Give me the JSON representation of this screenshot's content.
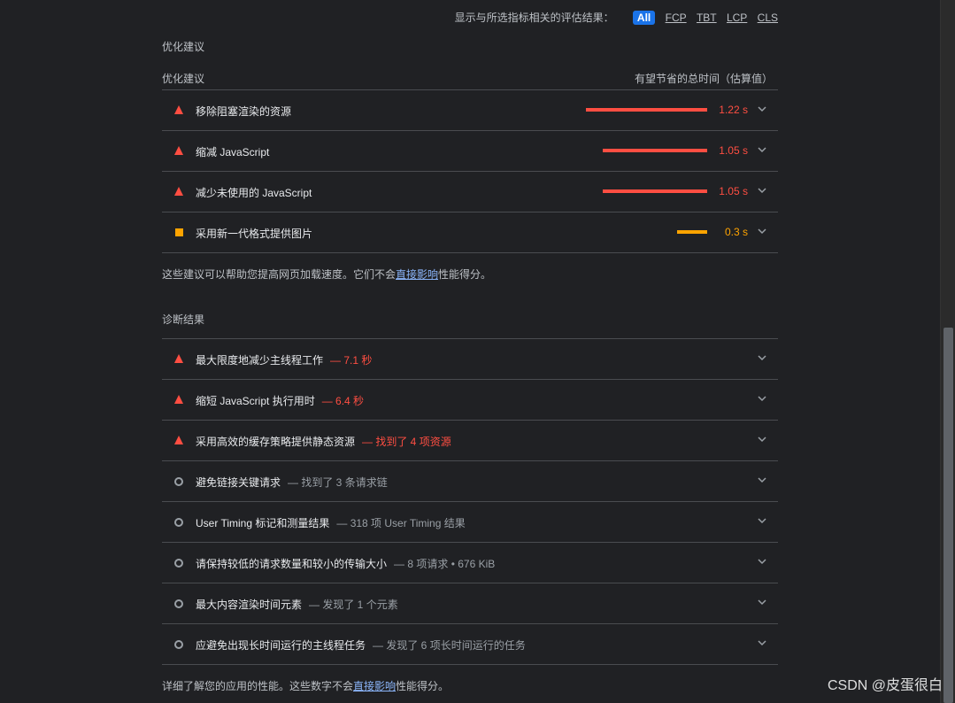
{
  "filter": {
    "label": "显示与所选指标相关的评估结果：",
    "buttons": [
      "All",
      "FCP",
      "TBT",
      "LCP",
      "CLS"
    ],
    "active": "All"
  },
  "opportunities": {
    "section_title": "优化建议",
    "col_left": "优化建议",
    "col_right": "有望节省的总时间（估算值）",
    "items": [
      {
        "title": "移除阻塞渲染的资源",
        "value": "1.22 s",
        "level": "fail",
        "savings_s": 1.22
      },
      {
        "title": "缩减 JavaScript",
        "value": "1.05 s",
        "level": "fail",
        "savings_s": 1.05
      },
      {
        "title": "减少未使用的 JavaScript",
        "value": "1.05 s",
        "level": "fail",
        "savings_s": 1.05
      },
      {
        "title": "采用新一代格式提供图片",
        "value": "0.3 s",
        "level": "average",
        "savings_s": 0.3
      }
    ],
    "footnote_pre": "这些建议可以帮助您提高网页加载速度。它们不会",
    "footnote_link": "直接影响",
    "footnote_post": "性能得分。"
  },
  "diagnostics": {
    "section_title": "诊断结果",
    "items": [
      {
        "title": "最大限度地减少主线程工作",
        "display": "— 7.1 秒",
        "level": "fail"
      },
      {
        "title": "缩短 JavaScript 执行用时",
        "display": "— 6.4 秒",
        "level": "fail"
      },
      {
        "title": "采用高效的缓存策略提供静态资源",
        "display": "— 找到了 4 项资源",
        "level": "fail"
      },
      {
        "title": "避免链接关键请求",
        "display": "— 找到了 3 条请求链",
        "level": "info"
      },
      {
        "title": "User Timing 标记和测量结果",
        "display": "— 318 项 User Timing 结果",
        "level": "info"
      },
      {
        "title": "请保持较低的请求数量和较小的传输大小",
        "display": "— 8 项请求 • 676 KiB",
        "level": "info"
      },
      {
        "title": "最大内容渲染时间元素",
        "display": "— 发现了 1 个元素",
        "level": "info"
      },
      {
        "title": "应避免出现长时间运行的主线程任务",
        "display": "— 发现了 6 项长时间运行的任务",
        "level": "info"
      }
    ],
    "footnote_pre": "详细了解您的应用的性能。这些数字不会",
    "footnote_link": "直接影响",
    "footnote_post": "性能得分。"
  },
  "watermark": "CSDN @皮蛋很白",
  "colors": {
    "fail": "#ff4e42",
    "average": "#ffa400",
    "info": "#9aa0a6",
    "accent": "#1a73e8",
    "link": "#8ab4f8"
  }
}
